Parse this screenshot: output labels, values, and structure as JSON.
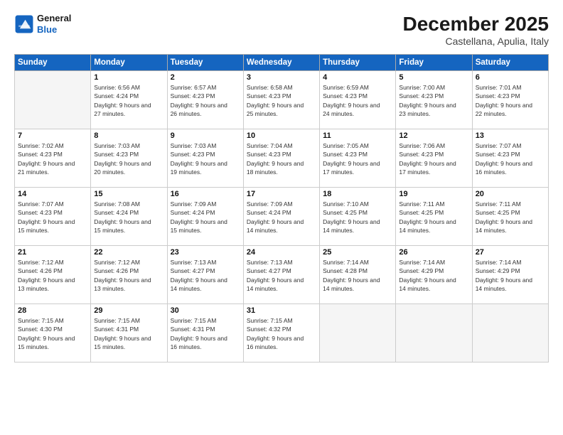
{
  "logo": {
    "line1": "General",
    "line2": "Blue"
  },
  "title": "December 2025",
  "location": "Castellana, Apulia, Italy",
  "days_header": [
    "Sunday",
    "Monday",
    "Tuesday",
    "Wednesday",
    "Thursday",
    "Friday",
    "Saturday"
  ],
  "weeks": [
    [
      {
        "day": "",
        "empty": true
      },
      {
        "day": "1",
        "sunrise": "6:56 AM",
        "sunset": "4:24 PM",
        "daylight": "9 hours and 27 minutes."
      },
      {
        "day": "2",
        "sunrise": "6:57 AM",
        "sunset": "4:23 PM",
        "daylight": "9 hours and 26 minutes."
      },
      {
        "day": "3",
        "sunrise": "6:58 AM",
        "sunset": "4:23 PM",
        "daylight": "9 hours and 25 minutes."
      },
      {
        "day": "4",
        "sunrise": "6:59 AM",
        "sunset": "4:23 PM",
        "daylight": "9 hours and 24 minutes."
      },
      {
        "day": "5",
        "sunrise": "7:00 AM",
        "sunset": "4:23 PM",
        "daylight": "9 hours and 23 minutes."
      },
      {
        "day": "6",
        "sunrise": "7:01 AM",
        "sunset": "4:23 PM",
        "daylight": "9 hours and 22 minutes."
      }
    ],
    [
      {
        "day": "7",
        "sunrise": "7:02 AM",
        "sunset": "4:23 PM",
        "daylight": "9 hours and 21 minutes."
      },
      {
        "day": "8",
        "sunrise": "7:03 AM",
        "sunset": "4:23 PM",
        "daylight": "9 hours and 20 minutes."
      },
      {
        "day": "9",
        "sunrise": "7:03 AM",
        "sunset": "4:23 PM",
        "daylight": "9 hours and 19 minutes."
      },
      {
        "day": "10",
        "sunrise": "7:04 AM",
        "sunset": "4:23 PM",
        "daylight": "9 hours and 18 minutes."
      },
      {
        "day": "11",
        "sunrise": "7:05 AM",
        "sunset": "4:23 PM",
        "daylight": "9 hours and 17 minutes."
      },
      {
        "day": "12",
        "sunrise": "7:06 AM",
        "sunset": "4:23 PM",
        "daylight": "9 hours and 17 minutes."
      },
      {
        "day": "13",
        "sunrise": "7:07 AM",
        "sunset": "4:23 PM",
        "daylight": "9 hours and 16 minutes."
      }
    ],
    [
      {
        "day": "14",
        "sunrise": "7:07 AM",
        "sunset": "4:23 PM",
        "daylight": "9 hours and 15 minutes."
      },
      {
        "day": "15",
        "sunrise": "7:08 AM",
        "sunset": "4:24 PM",
        "daylight": "9 hours and 15 minutes."
      },
      {
        "day": "16",
        "sunrise": "7:09 AM",
        "sunset": "4:24 PM",
        "daylight": "9 hours and 15 minutes."
      },
      {
        "day": "17",
        "sunrise": "7:09 AM",
        "sunset": "4:24 PM",
        "daylight": "9 hours and 14 minutes."
      },
      {
        "day": "18",
        "sunrise": "7:10 AM",
        "sunset": "4:25 PM",
        "daylight": "9 hours and 14 minutes."
      },
      {
        "day": "19",
        "sunrise": "7:11 AM",
        "sunset": "4:25 PM",
        "daylight": "9 hours and 14 minutes."
      },
      {
        "day": "20",
        "sunrise": "7:11 AM",
        "sunset": "4:25 PM",
        "daylight": "9 hours and 14 minutes."
      }
    ],
    [
      {
        "day": "21",
        "sunrise": "7:12 AM",
        "sunset": "4:26 PM",
        "daylight": "9 hours and 13 minutes."
      },
      {
        "day": "22",
        "sunrise": "7:12 AM",
        "sunset": "4:26 PM",
        "daylight": "9 hours and 13 minutes."
      },
      {
        "day": "23",
        "sunrise": "7:13 AM",
        "sunset": "4:27 PM",
        "daylight": "9 hours and 14 minutes."
      },
      {
        "day": "24",
        "sunrise": "7:13 AM",
        "sunset": "4:27 PM",
        "daylight": "9 hours and 14 minutes."
      },
      {
        "day": "25",
        "sunrise": "7:14 AM",
        "sunset": "4:28 PM",
        "daylight": "9 hours and 14 minutes."
      },
      {
        "day": "26",
        "sunrise": "7:14 AM",
        "sunset": "4:29 PM",
        "daylight": "9 hours and 14 minutes."
      },
      {
        "day": "27",
        "sunrise": "7:14 AM",
        "sunset": "4:29 PM",
        "daylight": "9 hours and 14 minutes."
      }
    ],
    [
      {
        "day": "28",
        "sunrise": "7:15 AM",
        "sunset": "4:30 PM",
        "daylight": "9 hours and 15 minutes."
      },
      {
        "day": "29",
        "sunrise": "7:15 AM",
        "sunset": "4:31 PM",
        "daylight": "9 hours and 15 minutes."
      },
      {
        "day": "30",
        "sunrise": "7:15 AM",
        "sunset": "4:31 PM",
        "daylight": "9 hours and 16 minutes."
      },
      {
        "day": "31",
        "sunrise": "7:15 AM",
        "sunset": "4:32 PM",
        "daylight": "9 hours and 16 minutes."
      },
      {
        "day": "",
        "empty": true
      },
      {
        "day": "",
        "empty": true
      },
      {
        "day": "",
        "empty": true
      }
    ]
  ]
}
